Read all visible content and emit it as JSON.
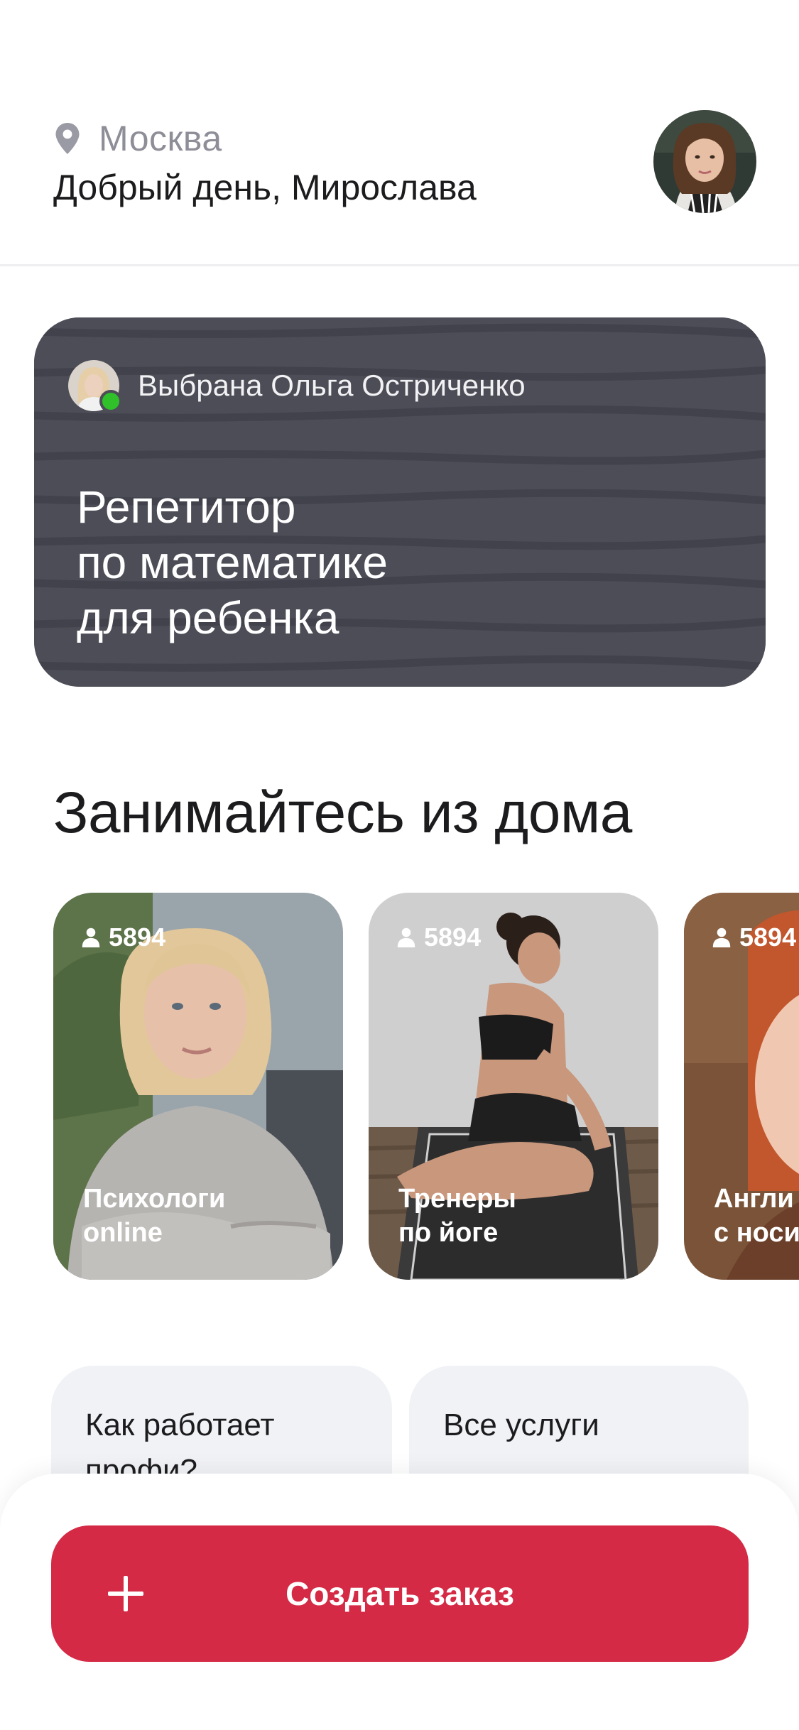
{
  "header": {
    "location_icon": "location-pin-icon",
    "city": "Москва",
    "greeting": "Добрый день, Мирослава",
    "avatar": "user-avatar"
  },
  "order_card": {
    "chosen_text": "Выбрана Ольга Остриченко",
    "title_lines": [
      "Репетитор",
      "по математике",
      "для ребенка"
    ],
    "online_color": "#2fc02a",
    "background_color": "#4c4d57"
  },
  "section": {
    "title": "Занимайтесь из дома"
  },
  "categories": [
    {
      "count": "5894",
      "label_lines": [
        "Психологи",
        "online"
      ]
    },
    {
      "count": "5894",
      "label_lines": [
        "Тренеры",
        "по йоге"
      ]
    },
    {
      "count": "5894",
      "label_lines": [
        "Англи",
        "с носи"
      ]
    }
  ],
  "tiles": [
    {
      "lines": [
        "Как работает",
        "профи?"
      ]
    },
    {
      "lines": [
        "Все услуги"
      ]
    }
  ],
  "cta": {
    "label": "Создать заказ",
    "icon": "plus-icon",
    "color": "#d42a45"
  }
}
